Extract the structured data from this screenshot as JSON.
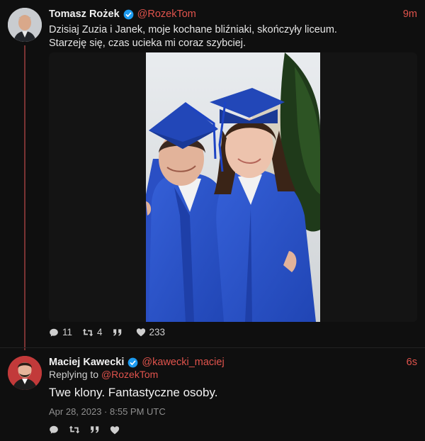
{
  "tweet1": {
    "name": "Tomasz Rożek",
    "handle": "@RozekTom",
    "time": "9m",
    "text_line1": "Dzisiaj Zuzia i Janek, moje kochane bliźniaki, skończyły liceum.",
    "text_line2": "Starzeję się, czas ucieka mi coraz szybciej.",
    "stats": {
      "replies": "11",
      "retweets": "4",
      "quotes": "",
      "likes": "233"
    }
  },
  "tweet2": {
    "name": "Maciej Kawecki",
    "handle": "@kawecki_maciej",
    "time": "6s",
    "replying_prefix": "Replying to",
    "replying_to": "@RozekTom",
    "text": "Twe klony. Fantastyczne osoby.",
    "date": "Apr 28, 2023 · 8:55 PM UTC"
  },
  "colors": {
    "accent": "#e0534c",
    "verified": "#1d9bf0",
    "background": "#0f0f0f",
    "gown": "#2a52c9"
  },
  "icons": [
    "verified-icon",
    "reply-icon",
    "retweet-icon",
    "quote-icon",
    "like-icon"
  ]
}
